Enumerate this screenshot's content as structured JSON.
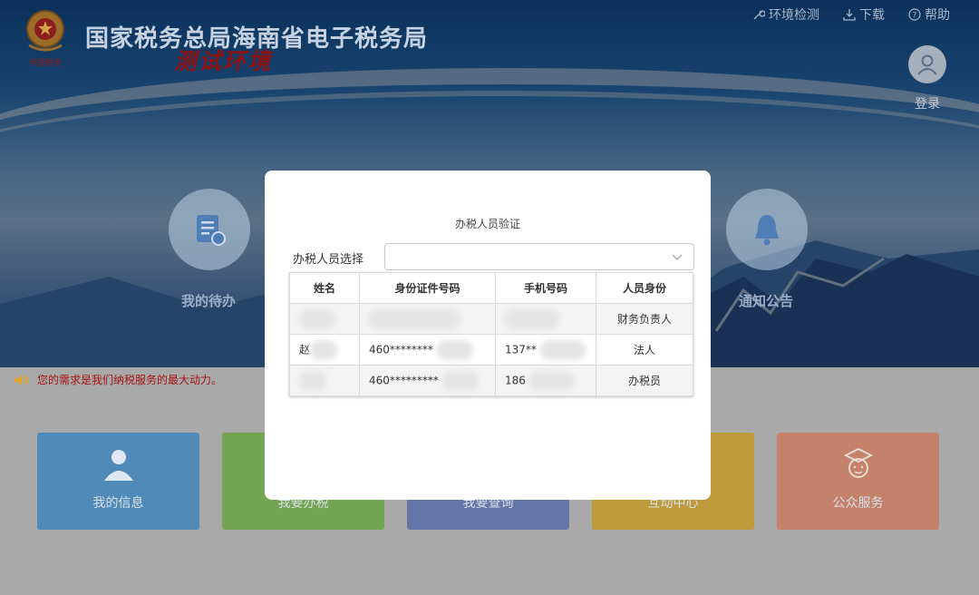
{
  "header": {
    "site_title": "国家税务总局海南省电子税务局",
    "test_env": "测试环境",
    "emblem_text": "中国税务"
  },
  "toplinks": [
    {
      "icon": "wrench-icon",
      "label": "环境检测"
    },
    {
      "icon": "download-icon",
      "label": "下载"
    },
    {
      "icon": "help-icon",
      "label": "帮助"
    }
  ],
  "login": {
    "label": "登录",
    "icon": "user-icon"
  },
  "hero_items": [
    {
      "icon": "task-list-icon",
      "label": "我的待办"
    },
    {
      "icon": "bell-icon",
      "label": "通知公告"
    }
  ],
  "notice": {
    "icon": "speaker-icon",
    "text": "您的需求是我们纳税服务的最大动力。"
  },
  "tiles": [
    {
      "label": "我的信息",
      "icon": "user-icon",
      "color": "#5b9fd6"
    },
    {
      "label": "我要办税",
      "icon": "",
      "color": "#84c35a"
    },
    {
      "label": "我要查询",
      "icon": "",
      "color": "#6d86c9"
    },
    {
      "label": "互动中心",
      "icon": "",
      "color": "#e2b33c"
    },
    {
      "label": "公众服务",
      "icon": "service-agent-icon",
      "color": "#e59364"
    }
  ],
  "modal": {
    "title": "办税人员验证",
    "select_label": "办税人员选择",
    "select_value": "",
    "columns": [
      "姓名",
      "身份证件号码",
      "手机号码",
      "人员身份"
    ],
    "rows": [
      {
        "name": "",
        "id": "",
        "phone": "",
        "role": "财务负责人"
      },
      {
        "name": "赵",
        "id": "460********",
        "phone": "137**",
        "role": "法人"
      },
      {
        "name": "",
        "id": "460*********",
        "phone": "186",
        "role": "办税员"
      }
    ]
  },
  "colors": {
    "hero_blue": "#1a5aa0",
    "notice_red": "#a51212",
    "test_env_red": "#8d1212"
  }
}
